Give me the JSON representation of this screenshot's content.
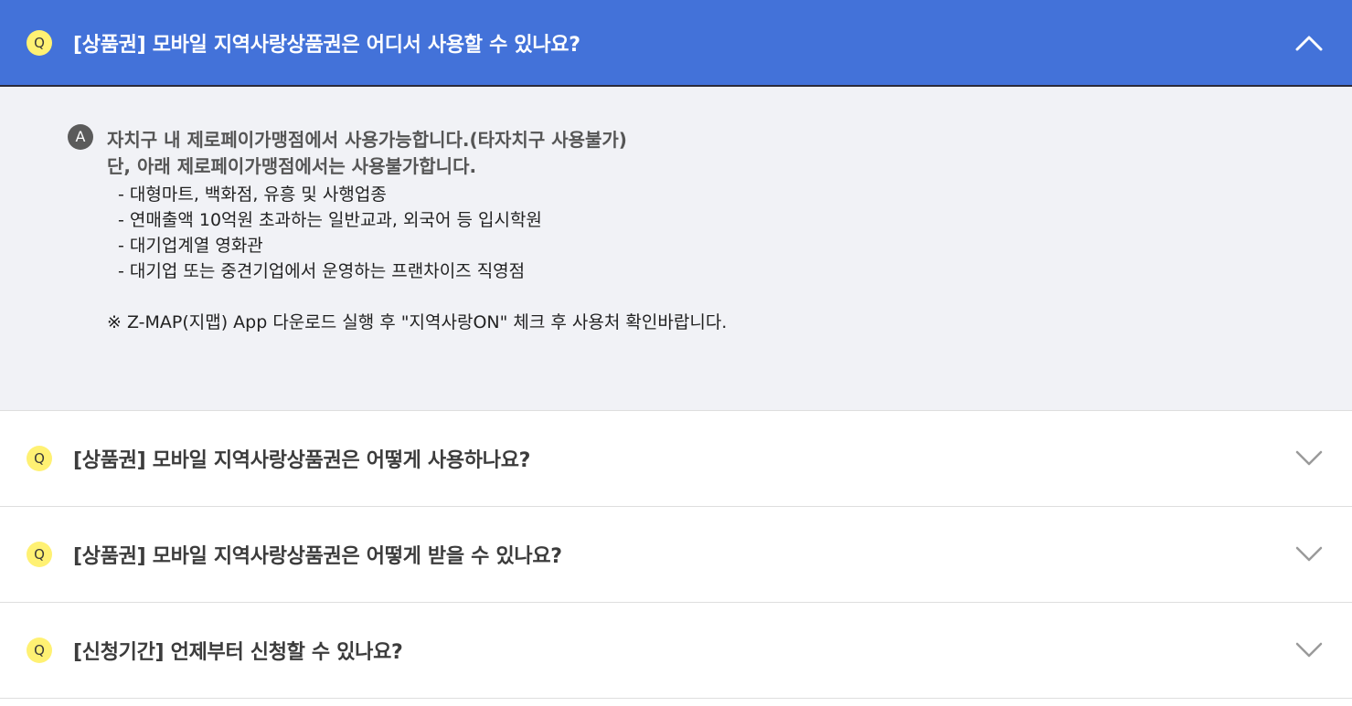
{
  "faq": {
    "open_item": {
      "badge": "Q",
      "question": "[상품권] 모바일 지역사랑상품권은 어디서 사용할 수 있나요?",
      "chevron_icon": "chevron-up-icon",
      "answer": {
        "badge": "A",
        "line1": "자치구 내 제로페이가맹점에서 사용가능합니다.(타자치구 사용불가)",
        "line2": "단, 아래 제로페이가맹점에서는 사용불가합니다.",
        "exclusions": [
          "- 대형마트, 백화점, 유흥 및 사행업종",
          "- 연매출액 10억원 초과하는 일반교과, 외국어 등 입시학원",
          "- 대기업계열 영화관",
          "- 대기업 또는 중견기업에서 운영하는 프랜차이즈 직영점"
        ],
        "note": "※ Z-MAP(지맵) App 다운로드 실행 후 \"지역사랑ON\" 체크 후 사용처 확인바랍니다."
      }
    },
    "closed_items": [
      {
        "badge": "Q",
        "question": "[상품권] 모바일 지역사랑상품권은 어떻게 사용하나요?"
      },
      {
        "badge": "Q",
        "question": "[상품권] 모바일 지역사랑상품권은 어떻게 받을 수 있나요?"
      },
      {
        "badge": "Q",
        "question": "[신청기간] 언제부터 신청할 수 있나요?"
      }
    ]
  },
  "colors": {
    "header_blue": "#4372d9",
    "q_badge_yellow": "#fff173",
    "answer_bg": "#f1f2f6",
    "a_badge_gray": "#5b5b5b"
  }
}
